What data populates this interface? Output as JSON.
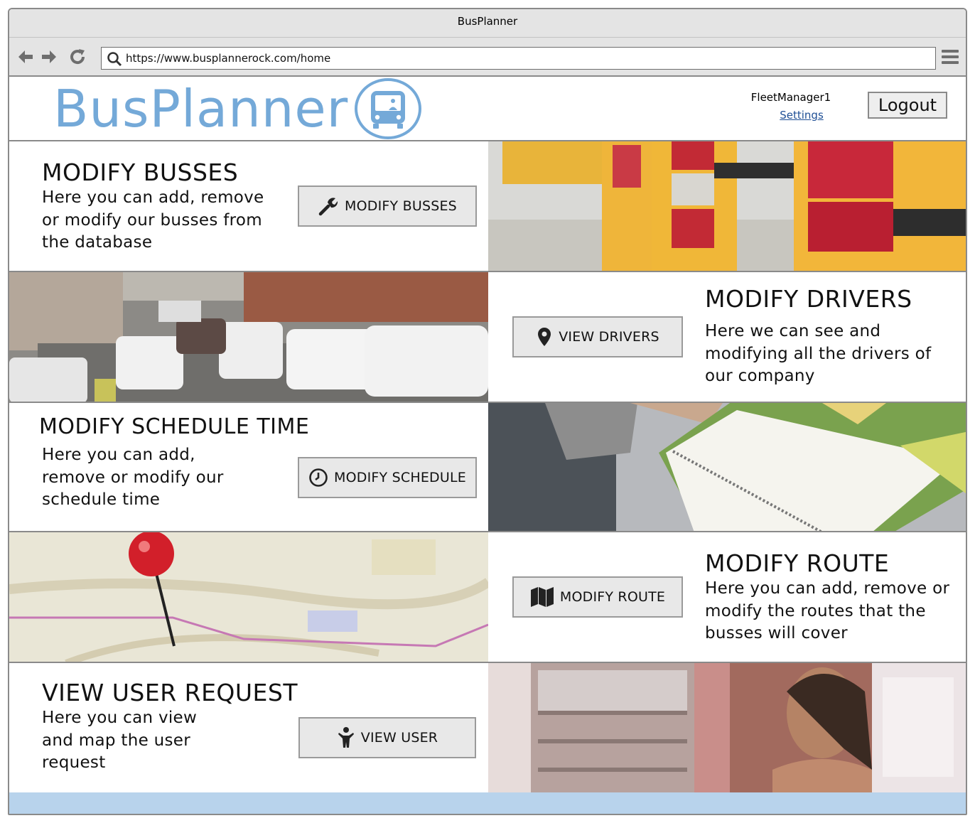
{
  "window": {
    "title": "BusPlanner"
  },
  "browser": {
    "url": "https://www.busplannerock.com/home"
  },
  "header": {
    "logo_text": "BusPlanner",
    "username": "FleetManager1",
    "settings_label": "Settings",
    "logout_label": "Logout"
  },
  "sections": [
    {
      "title": "MODIFY BUSSES",
      "description": "Here you can add, remove or modify our busses from the database",
      "button_label": "MODIFY BUSSES",
      "button_icon": "wrench-icon",
      "photo": "bus-taillights-photo"
    },
    {
      "title": "MODIFY DRIVERS",
      "description": "Here we can see and modifying all the drivers of our company",
      "button_label": "VIEW DRIVERS",
      "button_icon": "map-pin-icon",
      "photo": "minibus-traffic-photo"
    },
    {
      "title": "MODIFY SCHEDULE TIME",
      "description": "Here you can add, remove or modify our schedule time",
      "button_label": "MODIFY SCHEDULE",
      "button_icon": "clock-icon",
      "photo": "planner-notebook-photo"
    },
    {
      "title": "MODIFY ROUTE",
      "description": "Here you can add, remove or modify the routes that the busses will cover",
      "button_label": "MODIFY ROUTE",
      "button_icon": "folded-map-icon",
      "photo": "map-pushpin-photo"
    },
    {
      "title": "VIEW USER REQUEST",
      "description": "Here you can view and map the user request",
      "button_label": "VIEW USER",
      "button_icon": "person-icon",
      "photo": "passenger-window-photo"
    }
  ],
  "colors": {
    "brand": "#74a9d8",
    "link": "#1f4f95",
    "footer": "#b8d3ec",
    "button_bg": "#e8e8e8"
  }
}
